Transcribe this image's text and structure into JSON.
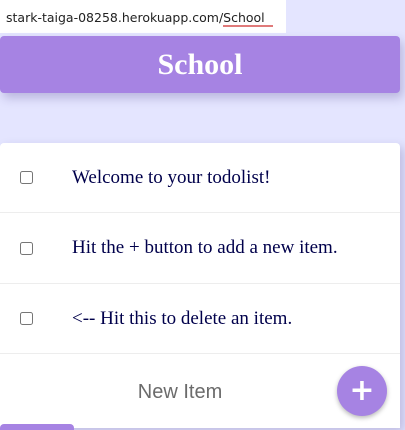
{
  "browser": {
    "url_host": "stark-taiga-08258.herokuapp.com/",
    "url_path": "School"
  },
  "header": {
    "title": "School"
  },
  "list": {
    "items": [
      {
        "text": "Welcome to your todolist!",
        "checked": false
      },
      {
        "text": "Hit the + button to add a new item.",
        "checked": false
      },
      {
        "text": "<-- Hit this to delete an item.",
        "checked": false
      }
    ]
  },
  "form": {
    "placeholder": "New Item",
    "add_label": "+"
  },
  "colors": {
    "accent": "#A683E3",
    "background": "#E4E5FF",
    "item_text": "#00004B"
  }
}
